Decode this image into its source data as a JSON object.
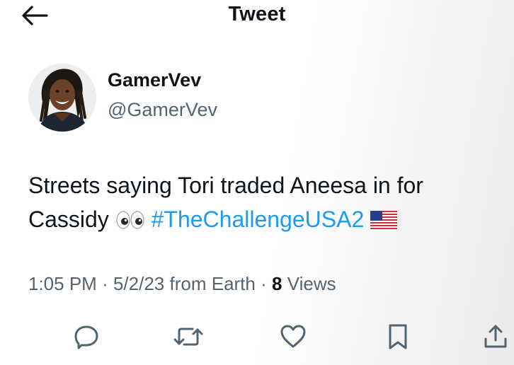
{
  "header": {
    "title": "Tweet",
    "back_icon": "arrow-left-icon"
  },
  "author": {
    "name": "GamerVev",
    "handle": "@GamerVev"
  },
  "tweet": {
    "text_part1": "Streets saying Tori traded Aneesa in for Cassidy",
    "emoji_eyes": "👀",
    "hashtag": "#TheChallengeUSA2",
    "emoji_flag": "🇺🇸"
  },
  "meta": {
    "time": "1:05 PM",
    "separator": "·",
    "date": "5/2/23",
    "source": "from Earth",
    "views_count": "8",
    "views_label": "Views"
  },
  "actions": {
    "reply_icon": "reply-icon",
    "retweet_icon": "retweet-icon",
    "like_icon": "heart-icon",
    "bookmark_icon": "bookmark-icon",
    "share_icon": "share-icon"
  },
  "colors": {
    "text": "#0f1419",
    "secondary": "#536471",
    "link": "#1d9bf0"
  }
}
